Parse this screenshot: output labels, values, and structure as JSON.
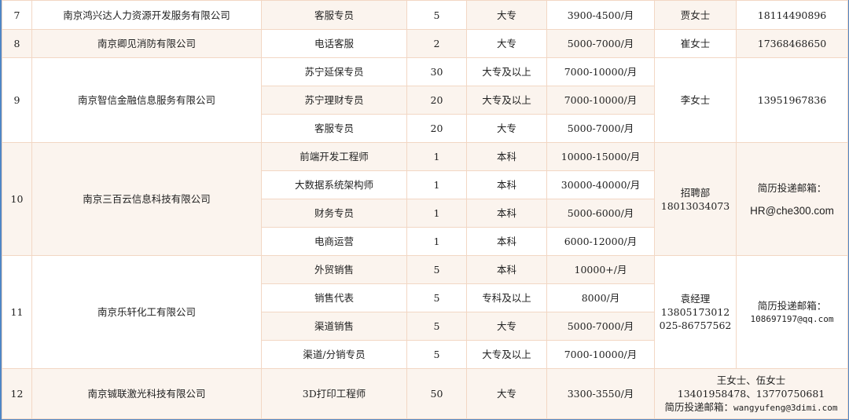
{
  "rows": [
    {
      "no": "7",
      "company": "南京鸿兴达人力资源开发服务有限公司",
      "position": "客服专员",
      "count": "5",
      "education": "大专",
      "salary": "3900-4500/月",
      "contact": "贾女士",
      "phone": "18114490896"
    },
    {
      "no": "8",
      "company": "南京卿见消防有限公司",
      "position": "电话客服",
      "count": "2",
      "education": "大专",
      "salary": "5000-7000/月",
      "contact": "崔女士",
      "phone": "17368468650"
    },
    {
      "no": "9",
      "company": "南京智信金融信息服务有限公司",
      "contact": "李女士",
      "phone": "13951967836",
      "jobs": [
        {
          "position": "苏宁延保专员",
          "count": "30",
          "education": "大专及以上",
          "salary": "7000-10000/月"
        },
        {
          "position": "苏宁理财专员",
          "count": "20",
          "education": "大专及以上",
          "salary": "7000-10000/月"
        },
        {
          "position": "客服专员",
          "count": "20",
          "education": "大专",
          "salary": "5000-7000/月"
        }
      ]
    },
    {
      "no": "10",
      "company": "南京三百云信息科技有限公司",
      "contact_line1": "招聘部",
      "contact_line2": "18013034073",
      "mail_label": "简历投递邮箱：",
      "mail": "HR@che300.com",
      "jobs": [
        {
          "position": "前端开发工程师",
          "count": "1",
          "education": "本科",
          "salary": "10000-15000/月"
        },
        {
          "position": "大数据系统架构师",
          "count": "1",
          "education": "本科",
          "salary": "30000-40000/月"
        },
        {
          "position": "财务专员",
          "count": "1",
          "education": "本科",
          "salary": "5000-6000/月"
        },
        {
          "position": "电商运营",
          "count": "1",
          "education": "本科",
          "salary": "6000-12000/月"
        }
      ]
    },
    {
      "no": "11",
      "company": "南京乐轩化工有限公司",
      "contact_line1": "袁经理",
      "contact_line2": "13805173012",
      "contact_line3": "025-86757562",
      "mail_label": "简历投递邮箱：",
      "mail": "108697197@qq.com",
      "jobs": [
        {
          "position": "外贸销售",
          "count": "5",
          "education": "本科",
          "salary": "10000+/月"
        },
        {
          "position": "销售代表",
          "count": "5",
          "education": "专科及以上",
          "salary": "8000/月"
        },
        {
          "position": "渠道销售",
          "count": "5",
          "education": "大专",
          "salary": "5000-7000/月"
        },
        {
          "position": "渠道/分销专员",
          "count": "5",
          "education": "大专及以上",
          "salary": "7000-10000/月"
        }
      ]
    },
    {
      "no": "12",
      "company": "南京铖联激光科技有限公司",
      "position": "3D打印工程师",
      "count": "50",
      "education": "大专",
      "salary": "3300-3550/月",
      "contact_line1": "王女士、伍女士",
      "contact_line2": "13401958478、13770750681",
      "mail_label": "简历投递邮箱：",
      "mail": "wangyufeng@3dimi.com"
    }
  ]
}
